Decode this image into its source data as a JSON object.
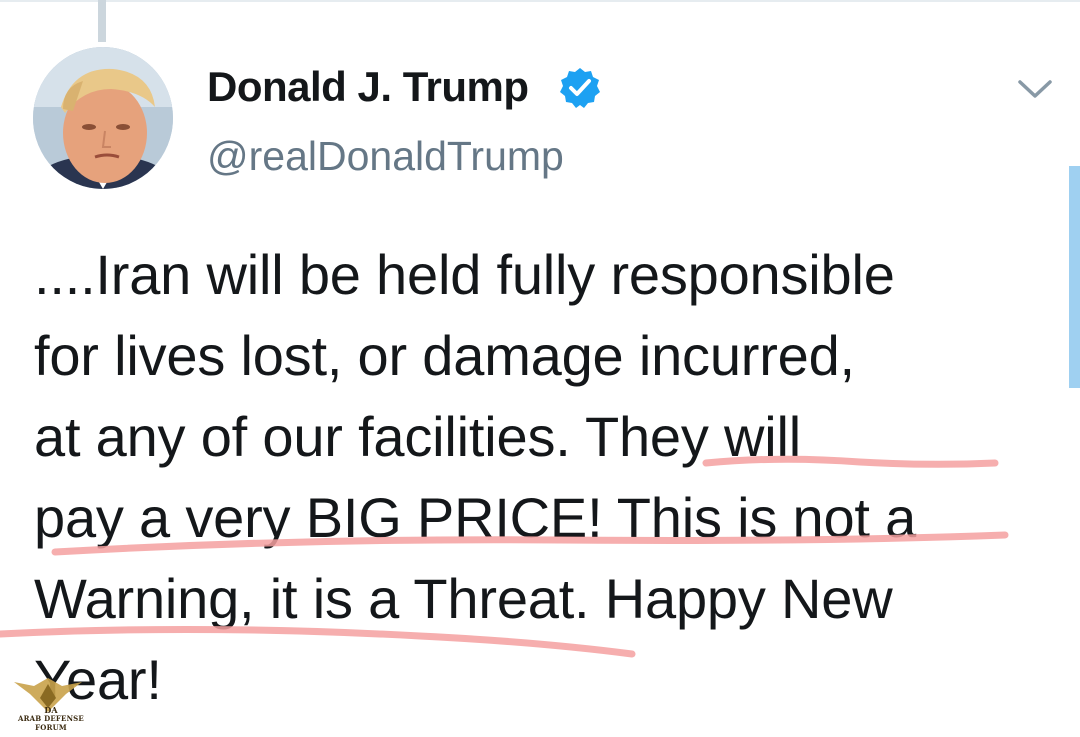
{
  "tweet": {
    "display_name": "Donald J. Trump",
    "handle": "@realDonaldTrump",
    "verified": true,
    "text_lines": [
      "....Iran will be held fully responsible",
      "for lives lost, or damage incurred,",
      "at any of our facilities. They will",
      "pay a very BIG PRICE! This is not a",
      "Warning, it is a Threat. Happy New",
      "Year!"
    ]
  },
  "icons": {
    "verified": "verified-badge-icon",
    "menu": "chevron-down-icon",
    "avatar": "profile-avatar"
  },
  "colors": {
    "verified_blue": "#1da1f2",
    "handle_gray": "#657786",
    "underline_red": "#f4a3a3",
    "scrollbar": "#9fd0f1"
  },
  "watermark": {
    "abbr": "DA",
    "text": "ARAB DEFENSE FORUM"
  }
}
